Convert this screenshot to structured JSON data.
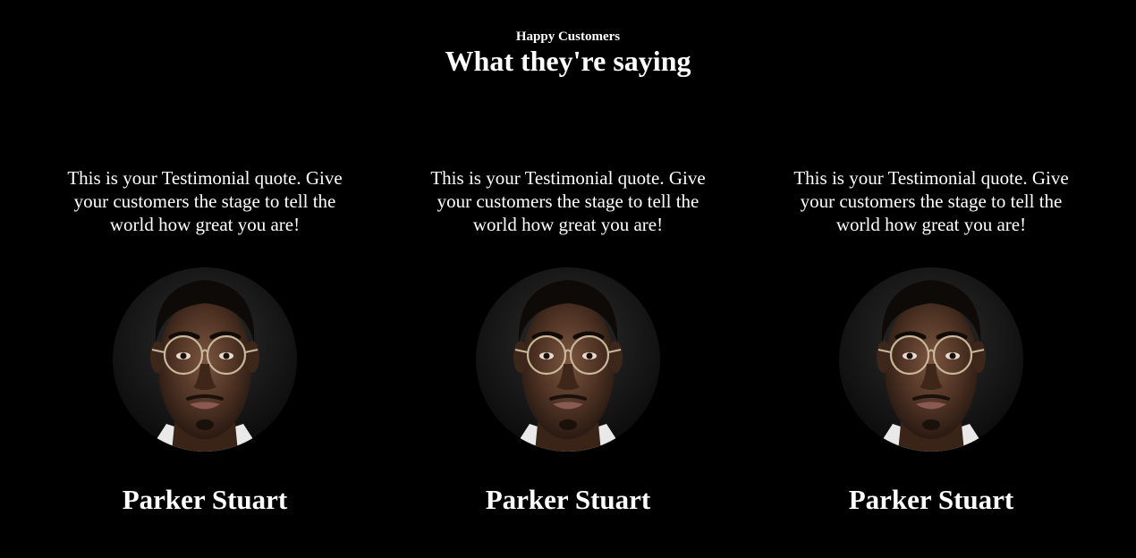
{
  "header": {
    "eyebrow": "Happy Customers",
    "title": "What they're saying"
  },
  "testimonials": [
    {
      "quote": "This is your Testimonial quote. Give your customers the stage to tell the world how great you are!",
      "name": "Parker Stuart"
    },
    {
      "quote": "This is your Testimonial quote. Give your customers the stage to tell the world how great you are!",
      "name": "Parker Stuart"
    },
    {
      "quote": "This is your Testimonial quote. Give your customers the stage to tell the world how great you are!",
      "name": "Parker Stuart"
    }
  ],
  "colors": {
    "background": "#000000",
    "text": "#ffffff"
  }
}
